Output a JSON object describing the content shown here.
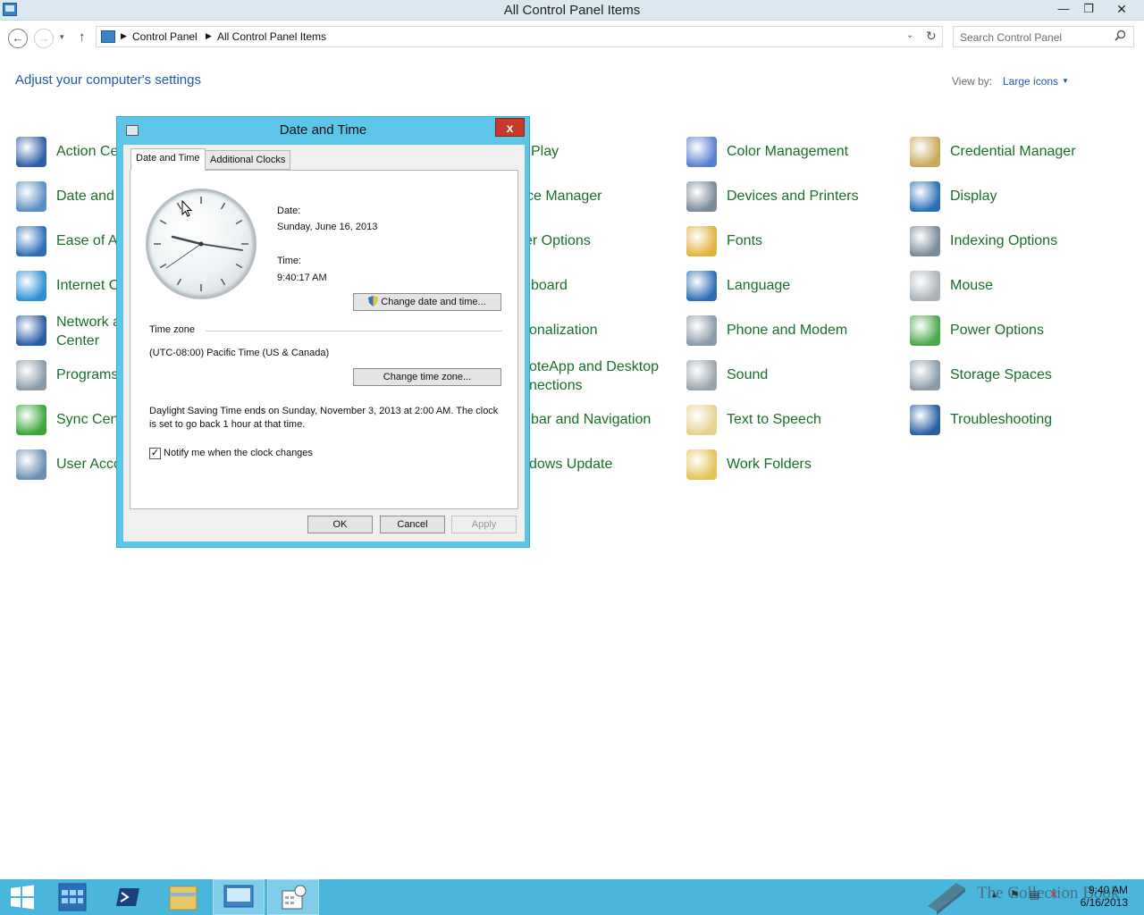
{
  "window": {
    "title": "All Control Panel Items",
    "minimize": "—",
    "maximize": "❐",
    "close": "✕"
  },
  "nav": {
    "back": "←",
    "forward": "→",
    "recent": "▾",
    "up": "↑",
    "breadcrumbs": [
      "Control Panel",
      "All Control Panel Items"
    ],
    "address_dropdown": "⌄",
    "refresh": "↻",
    "search_placeholder": "Search Control Panel"
  },
  "header": {
    "title": "Adjust your computer's settings",
    "view_by_label": "View by:",
    "view_by_value": "Large icons"
  },
  "items": [
    {
      "label": "Action Center",
      "visible": "Action Ce",
      "icon": "flag-icon",
      "color": "#2d5fa8"
    },
    {
      "label": "Date and Time",
      "visible": "Date and T",
      "icon": "calendar-clock-icon",
      "color": "#5b8fc4"
    },
    {
      "label": "Ease of Access Center",
      "visible": "Ease of Ac",
      "icon": "ease-of-access-icon",
      "color": "#2d6fb5"
    },
    {
      "label": "Internet Options",
      "visible": "Internet O",
      "icon": "globe-check-icon",
      "color": "#2f8fd4"
    },
    {
      "label": "Network and Sharing Center",
      "visible": "Network a\nCenter",
      "icon": "network-icon",
      "color": "#2a5da4"
    },
    {
      "label": "Programs and Features",
      "visible": "Programs",
      "icon": "programs-icon",
      "color": "#8a9aa8"
    },
    {
      "label": "Sync Center",
      "visible": "Sync Cent",
      "icon": "sync-icon",
      "color": "#3aa63a"
    },
    {
      "label": "User Accounts",
      "visible": "User Acco",
      "icon": "users-icon",
      "color": "#6b8fb4"
    },
    {
      "label": "AutoPlay",
      "visible": "Play",
      "icon": "autoplay-icon",
      "color": "#4a7fc0"
    },
    {
      "label": "Device Manager",
      "visible": "ce Manager",
      "icon": "device-manager-icon",
      "color": "#7a8a99"
    },
    {
      "label": "Folder Options",
      "visible": "er Options",
      "icon": "folder-options-icon",
      "color": "#e0b84a"
    },
    {
      "label": "Keyboard",
      "visible": "board",
      "icon": "keyboard-icon",
      "color": "#8a8a8a"
    },
    {
      "label": "Personalization",
      "visible": "onalization",
      "icon": "personalization-icon",
      "color": "#4a7fc0"
    },
    {
      "label": "RemoteApp and Desktop Connections",
      "visible": "oteApp and Desktop\nnections",
      "icon": "remoteapp-icon",
      "color": "#4a7fc0"
    },
    {
      "label": "Taskbar and Navigation",
      "visible": "bar and Navigation",
      "icon": "taskbar-icon",
      "color": "#4a7fc0"
    },
    {
      "label": "Windows Update",
      "visible": "dows Update",
      "icon": "windows-update-icon",
      "color": "#3a8a3a"
    },
    {
      "label": "Color Management",
      "visible": "Color Management",
      "icon": "color-management-icon",
      "color": "#5a7fd0"
    },
    {
      "label": "Devices and Printers",
      "visible": "Devices and Printers",
      "icon": "printer-icon",
      "color": "#7a8a99"
    },
    {
      "label": "Fonts",
      "visible": "Fonts",
      "icon": "fonts-icon",
      "color": "#e1b23d"
    },
    {
      "label": "Language",
      "visible": "Language",
      "icon": "language-icon",
      "color": "#2d6fb5"
    },
    {
      "label": "Phone and Modem",
      "visible": "Phone and Modem",
      "icon": "phone-icon",
      "color": "#8a9aa8"
    },
    {
      "label": "Sound",
      "visible": "Sound",
      "icon": "speaker-icon",
      "color": "#9aa5ab"
    },
    {
      "label": "Text to Speech",
      "visible": "Text to Speech",
      "icon": "speech-icon",
      "color": "#e6d28f"
    },
    {
      "label": "Work Folders",
      "visible": "Work Folders",
      "icon": "work-folders-icon",
      "color": "#e6c35a"
    },
    {
      "label": "Credential Manager",
      "visible": "Credential Manager",
      "icon": "vault-icon",
      "color": "#c8a85a"
    },
    {
      "label": "Display",
      "visible": "Display",
      "icon": "monitor-icon",
      "color": "#2a6fb8"
    },
    {
      "label": "Indexing Options",
      "visible": "Indexing Options",
      "icon": "magnifier-icon",
      "color": "#7a8a99"
    },
    {
      "label": "Mouse",
      "visible": "Mouse",
      "icon": "mouse-icon",
      "color": "#aab2b8"
    },
    {
      "label": "Power Options",
      "visible": "Power Options",
      "icon": "battery-icon",
      "color": "#4aa84a"
    },
    {
      "label": "Storage Spaces",
      "visible": "Storage Spaces",
      "icon": "storage-icon",
      "color": "#8a9aa8"
    },
    {
      "label": "Troubleshooting",
      "visible": "Troubleshooting",
      "icon": "troubleshoot-icon",
      "color": "#2a5da4"
    }
  ],
  "dialog": {
    "title": "Date and Time",
    "close": "x",
    "tabs": [
      "Date and Time",
      "Additional Clocks"
    ],
    "date_label": "Date:",
    "date_value": "Sunday, June 16, 2013",
    "time_label": "Time:",
    "time_value": "9:40:17 AM",
    "change_datetime_button": "Change date and time...",
    "timezone_heading": "Time zone",
    "timezone_value": "(UTC-08:00) Pacific Time (US & Canada)",
    "change_timezone_button": "Change time zone...",
    "dst_note": "Daylight Saving Time ends on Sunday, November 3, 2013 at 2:00 AM. The clock is set to go back 1 hour at that time.",
    "notify_checkbox_label": "Notify me when the clock changes",
    "notify_checked": true,
    "ok": "OK",
    "cancel": "Cancel",
    "apply": "Apply"
  },
  "taskbar": {
    "buttons": [
      "start-icon",
      "server-manager-icon",
      "powershell-icon",
      "file-explorer-icon",
      "control-panel-icon",
      "date-time-icon"
    ],
    "watermark": "The Collection Book",
    "clock_time": "9:40 AM",
    "clock_date": "6/16/2013"
  }
}
